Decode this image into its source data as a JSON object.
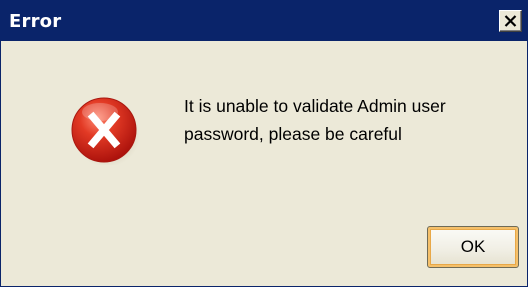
{
  "dialog": {
    "title": "Error",
    "message": "It is unable to validate Admin user password, please be careful",
    "ok_label": "OK",
    "icon": "error-icon",
    "close_icon": "close-icon"
  },
  "colors": {
    "titlebar": "#0a246a",
    "title_text": "#ffffff",
    "dialog_bg": "#ece9d8",
    "error_red": "#cc1f16",
    "ok_focus": "#f5c06a"
  }
}
